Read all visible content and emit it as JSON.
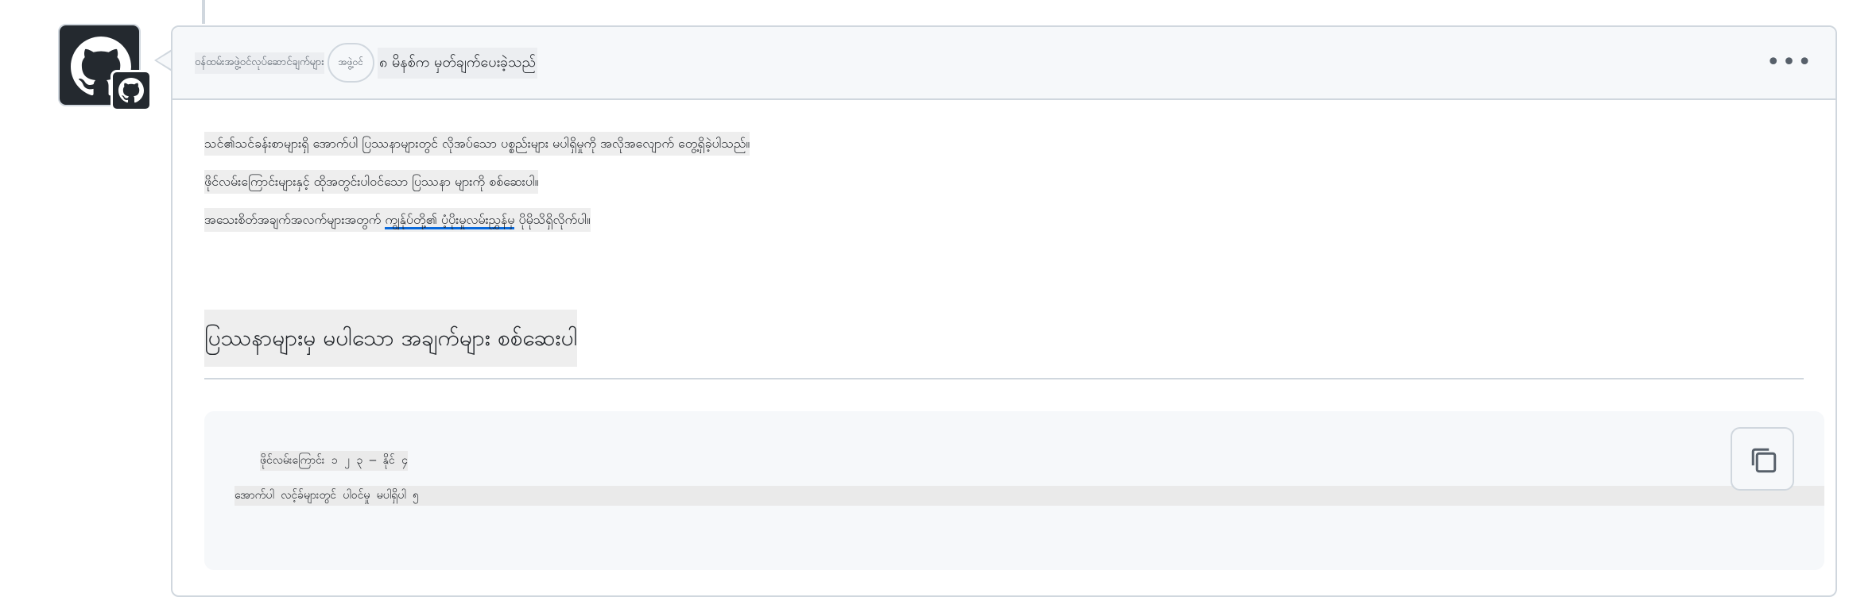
{
  "comment": {
    "author": "ဝန်ထမ်းအဖွဲ့ဝင်လုပ်ဆောင်ချက်များ",
    "role_badge": "အဖွဲ့ဝင်",
    "timestamp_text": "၈ မိနစ်က မှတ်ချက်ပေးခဲ့သည်",
    "menu_label": "•••"
  },
  "body": {
    "para1": "သင်၏သင်ခန်းစာများရှိ အောက်ပါ ပြဿနာများတွင် လိုအပ်သော ပစ္စည်းများ မပါရှိမှုကို အလိုအလျောက် တွေ့ရှိခဲ့ပါသည်။",
    "para2": "ဖိုင်လမ်းကြောင်းများနှင့် ထိုအတွင်းပါဝင်သော ပြဿနာ များကို စစ်ဆေးပါ။",
    "para3_prefix": "အသေးစိတ်အချက်အလက်များအတွက်",
    "para3_link": "ကျွန်ုပ်တို့၏ ပံ့ပိုးမှုလမ်းညွှန်မှ",
    "para3_suffix": " ပိုမိုသိရှိလိုက်ပါ။",
    "heading": "ပြဿနာများမှ မပါသော အချက်များ စစ်ဆေးပါ",
    "code_line1": "ဖိုင်လမ်းကြောင်း ၁ ၂ ၃ — နိုင် ၄",
    "code_line2": "အောက်ပါ လင့်ခ်များတွင် ပါဝင်မှု မပါရှိပါ ၅",
    "code_line3": ""
  },
  "icons": {
    "avatar": "github-octocat-icon",
    "badge": "github-app-badge-icon",
    "copy": "copy-icon"
  }
}
